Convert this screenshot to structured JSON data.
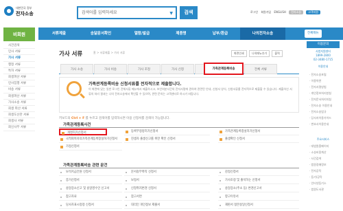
{
  "site": {
    "logo_line1": "대한민국 정부",
    "logo_line2": "전자소송"
  },
  "search": {
    "placeholder": "검색어를 입력하세요",
    "button": "검색"
  },
  "utility": {
    "items": [
      "로그인",
      "회원가입",
      "ENGLISH"
    ],
    "pills": [
      "전자소송",
      "고객지원"
    ]
  },
  "nav": {
    "items": [
      "서류제출",
      "송달문서확인",
      "열람/발급",
      "제증명",
      "납부/환급",
      "나의전자소송"
    ],
    "active_index": 5,
    "all_menu": "전체메뉴"
  },
  "left": {
    "heading": "비회원",
    "items": [
      "사건검색",
      "민사 서류",
      "가사 서류",
      "행정 서류",
      "특허 서류",
      "회생파산 서류",
      "민사집행 서류",
      "비송 서류",
      "회생파산 서류",
      "가사소송 서류",
      "회생 파산 서류",
      "회생도산관 서류",
      "회생사 서류",
      "회신사무 서류"
    ],
    "active_index": 2
  },
  "page": {
    "title": "가사 서류",
    "breadcrumb": "홈 > 서류제출 > 가사 서류",
    "tools": [
      "화면인쇄",
      "나의메뉴추가",
      "출력"
    ]
  },
  "tabs": [
    "가사 소송",
    "가사 비송",
    "가사 조정",
    "가사 신청",
    "과태료/감치",
    "가족관계등록비송",
    "전체 서류"
  ],
  "active_tab": 5,
  "info": {
    "headline": "가족관계등록비송 신청서류를 전자적으로 제출합니다.",
    "body": "이 화면에 있는 일반 로그인 전체서류 메뉴에서 제출하시고, 보안처분사건의 전자서명에 관하여 관련된 안내, 신청서 양식, 신청서류를 전자적으로 제출할 수 있습니다. 제출하신 서류의 처리 결과는 나의 전자소송에서 확인할 수 있으며, 관련 문의는 고객센터로 하시기 바랍니다."
  },
  "keyboard_hint": {
    "prefix": "키보드의",
    "key": "Ctrl + F",
    "suffix": "를 누르고 검색어를 입력하시면 이용 신청서를 검색이 가능합니다."
  },
  "section1": {
    "title": "가족관계등록사건",
    "items": [
      "개명허가신청서",
      "등록부정정허가신청서",
      "가족관계등록창설허가신청서",
      "국적회복자의가족관계등록창설허가신청서",
      "친생자 출생신고를 위한 확인 신청서",
      "출생확인 신청서",
      "가정신청서"
    ],
    "highlight_index": 0
  },
  "section2": {
    "title": "가족관계등록비송 관련 문건",
    "items": [
      "보석지급전원 신청서",
      "문서송부촉탁 신청서",
      "감정신청서",
      "증거신청서",
      "보정서",
      "가사조정 및 출석하는 신청서",
      "송달장소신고 및 송달영수인 신고서",
      "신청취지변경 신청서",
      "송달장소(주소 등) 변경신고서",
      "참고자료",
      "참고서면",
      "항고이유서",
      "당사자표시정정 신청서",
      "대리인 개인정보 제출서",
      "재판서 정본송달신청서"
    ]
  },
  "right": {
    "heading": "이용문의",
    "contact": [
      "사법지원센터",
      "1899-2800",
      "02-3480-1715"
    ],
    "today": "이용안내",
    "links": [
      "전자소송포털",
      "이용약관",
      "전자서명방법",
      "개인정보처리방침",
      "전자문서처리지침",
      "전자소송 이용안내",
      "전자소송법규",
      "당사자이용가이드",
      "변호사이용안내"
    ],
    "bottom_heading": "주요서비스",
    "bottom_links": [
      "대법원홈페이지",
      "소송비용계산",
      "사건검색",
      "법원경매정보",
      "전자공탁",
      "등기/공탁",
      "인터넷등기소",
      "법원도서관"
    ]
  }
}
